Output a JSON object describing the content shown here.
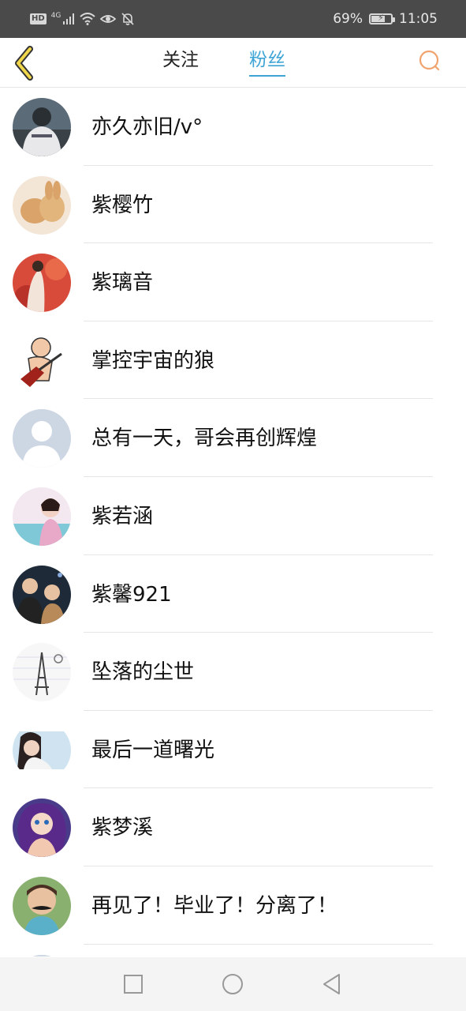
{
  "status_bar": {
    "hd": "HD",
    "network": "4G",
    "battery_percent": "69%",
    "battery_level": 0.69,
    "time": "11:05",
    "icons": [
      "hd-icon",
      "signal-icon",
      "wifi-icon",
      "eye-comfort-icon",
      "mute-bell-icon",
      "battery-icon"
    ]
  },
  "header": {
    "tabs": [
      {
        "label": "关注",
        "active": false
      },
      {
        "label": "粉丝",
        "active": true
      }
    ],
    "accent_color": "#3ea4d6",
    "back_icon": "chevron-left-icon",
    "search_icon": "search-icon"
  },
  "fans": [
    {
      "name": "亦久亦旧/v°"
    },
    {
      "name": "紫樱竹"
    },
    {
      "name": "紫璃音"
    },
    {
      "name": "掌控宇宙的狼"
    },
    {
      "name": "总有一天，哥会再创辉煌"
    },
    {
      "name": "紫若涵"
    },
    {
      "name": "紫馨921"
    },
    {
      "name": "坠落的尘世"
    },
    {
      "name": "最后一道曙光"
    },
    {
      "name": "紫梦溪"
    },
    {
      "name": "再见了！毕业了！分离了！"
    }
  ],
  "nav_bar": {
    "icons": [
      "recents-square-icon",
      "home-circle-icon",
      "back-triangle-icon"
    ]
  }
}
